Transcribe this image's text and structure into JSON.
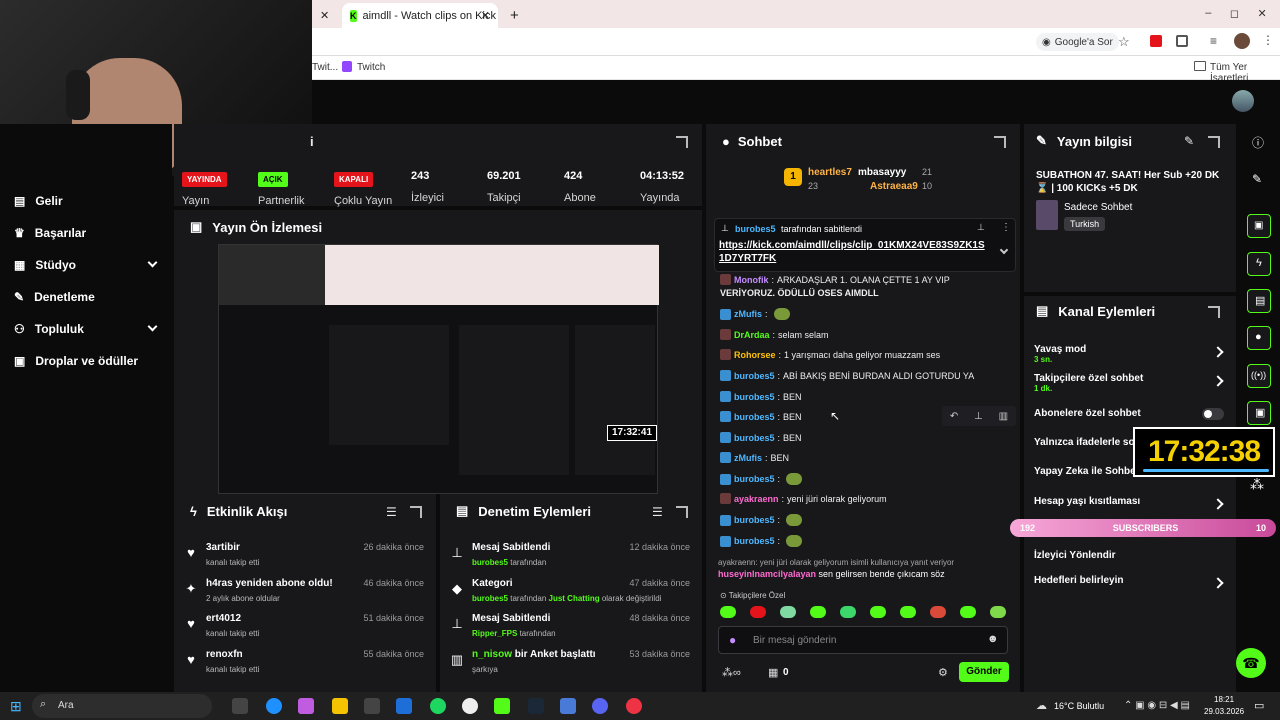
{
  "browser": {
    "tab_title": "aimdll - Watch clips on Kick",
    "new_tab": "+",
    "window_controls": [
      "–",
      "◻",
      "✕"
    ],
    "google_sor": "Google'a Sor",
    "bookmarks": [
      "Twit...",
      "Twitch"
    ],
    "all_bookmarks": "Tüm Yer İşaretleri"
  },
  "sidebar": {
    "items": [
      {
        "label": "Gelir",
        "icon": "bank-icon"
      },
      {
        "label": "Başarılar",
        "icon": "trophy-icon"
      },
      {
        "label": "Stüdyo",
        "icon": "studio-icon",
        "expand": true
      },
      {
        "label": "Denetleme",
        "icon": "wrench-icon"
      },
      {
        "label": "Topluluk",
        "icon": "community-icon",
        "expand": true
      },
      {
        "label": "Droplar ve ödüller",
        "icon": "gift-icon"
      }
    ]
  },
  "stats": {
    "title_partial": "i",
    "items": [
      {
        "badge": "YAYINDA",
        "badge_color": "#e5141b",
        "label": "Yayın"
      },
      {
        "badge": "AÇIK",
        "badge_color": "#53fc18",
        "label": "Partnerlik"
      },
      {
        "badge": "KAPALI",
        "badge_color": "#e5141b",
        "label": "Çoklu Yayın"
      },
      {
        "value": "243",
        "label": "İzleyici"
      },
      {
        "value": "69.201",
        "label": "Takipçi"
      },
      {
        "value": "424",
        "label": "Abone"
      },
      {
        "value": "04:13:52",
        "label": "Yayında"
      }
    ]
  },
  "preview": {
    "title": "Yayın Ön İzlemesi",
    "clock": "17:32:41"
  },
  "activity": {
    "title": "Etkinlik Akışı",
    "items": [
      {
        "name": "3artibir",
        "sub": "kanalı takip etti",
        "ago": "26 dakika önce",
        "icon": "heart-icon"
      },
      {
        "name": "h4ras yeniden abone oldu!",
        "sub": "2 aylık abone oldular",
        "ago": "46 dakika önce",
        "icon": "star-icon"
      },
      {
        "name": "ert4012",
        "sub": "kanalı takip etti",
        "ago": "51 dakika önce",
        "icon": "heart-icon"
      },
      {
        "name": "renoxfn",
        "sub": "kanalı takip etti",
        "ago": "55 dakika önce",
        "icon": "heart-icon"
      }
    ]
  },
  "moderation": {
    "title": "Denetim Eylemleri",
    "items": [
      {
        "title": "Mesaj Sabitlendi",
        "user": "burobes5",
        "rest": " tarafından",
        "ago": "12 dakika önce",
        "icon": "pin-icon"
      },
      {
        "title": "Kategori",
        "user": "burobes5",
        "rest": " tarafından ",
        "cat": "Just Chatting",
        "rest2": " olarak değiştirildi",
        "ago": "47 dakika önce",
        "icon": "tag-icon"
      },
      {
        "title": "Mesaj Sabitlendi",
        "user": "Ripper_FPS",
        "rest": " tarafından",
        "ago": "48 dakika önce",
        "icon": "pin-icon"
      },
      {
        "title_user": "n_nisow",
        "title_rest": " bir Anket başlattı",
        "sub": "şarkıya",
        "ago": "53 dakika önce",
        "icon": "poll-icon"
      }
    ]
  },
  "chat": {
    "title": "Sohbet",
    "leaders": [
      {
        "rank": "1",
        "name": "heartles7",
        "count": "23"
      },
      {
        "name": "mbasayyy",
        "count": "21"
      },
      {
        "name": "Astraeaa9",
        "count": "10"
      }
    ],
    "pinned": {
      "by": "burobes5",
      "by_rest": " tarafından sabitlendi",
      "link": "https://kick.com/aimdll/clips/clip_01KMX24VE83S9ZK1S1D7YRT7FK"
    },
    "messages": [
      {
        "user": "Monofik",
        "color": "#c48cff",
        "text": " ARKADAŞLAR 1. OLANA ÇETTE 1 AY VIP"
      },
      {
        "user": "",
        "color": "#ffffff",
        "text": "VERİYORUZ. ÖDÜLLÜ OSES AIMDLL"
      },
      {
        "user": "zMufis",
        "color": "#4db8ff",
        "text": "",
        "emote": true
      },
      {
        "user": "DrArdaa",
        "color": "#53fc18",
        "text": " selam selam"
      },
      {
        "user": "Rohorsee",
        "color": "#ffc107",
        "text": " 1 yarışmacı daha geliyor muazzam ses"
      },
      {
        "user": "burobes5",
        "color": "#4db8ff",
        "text": " ABİ BAKIŞ BENİ BURDAN ALDI GOTURDU YA"
      },
      {
        "user": "burobes5",
        "color": "#4db8ff",
        "text": " BEN"
      },
      {
        "user": "burobes5",
        "color": "#4db8ff",
        "text": " BEN"
      },
      {
        "user": "burobes5",
        "color": "#4db8ff",
        "text": " BEN"
      },
      {
        "user": "zMufis",
        "color": "#4db8ff",
        "text": " BEN"
      },
      {
        "user": "burobes5",
        "color": "#4db8ff",
        "text": "",
        "emote": true
      },
      {
        "user": "ayakraenn",
        "color": "#ff6bd0",
        "text": " yeni jüri olarak geliyorum"
      },
      {
        "user": "burobes5",
        "color": "#4db8ff",
        "text": "",
        "emote": true
      },
      {
        "user": "burobes5",
        "color": "#4db8ff",
        "text": "",
        "emote": true
      }
    ],
    "reply_context": "ayakraenn: yeni jüri olarak geliyorum     isimli kullanıcıya yanıt veriyor",
    "reply_user": "huseyinlnamcilyalayan",
    "reply_text": " sen gelirsen bende çıkıcam söz",
    "followers_only": "Takipçilere Özel",
    "input_placeholder": "Bir mesaj gönderin",
    "points": "0",
    "send": "Gönder"
  },
  "stream_info": {
    "title": "Yayın bilgisi",
    "stream_title": "SUBATHON 47. SAAT! Her Sub +20 DK ⌛ | 100 KICKs +5 DK",
    "category": "Sadece Sohbet",
    "language": "Turkish"
  },
  "channel_actions": {
    "title": "Kanal Eylemleri",
    "items": [
      {
        "label": "Yavaş mod",
        "sub": "3 sn.",
        "type": "chevron"
      },
      {
        "label": "Takipçilere özel sohbet",
        "sub": "1 dk.",
        "type": "chevron"
      },
      {
        "label": "Abonelere özel sohbet",
        "sub": "",
        "type": "toggle"
      },
      {
        "label": "Yalnızca ifadelerle sohbet",
        "sub": "",
        "type": "none"
      },
      {
        "label": "Yapay Zeka ile Sohbet",
        "sub": "",
        "type": "none"
      },
      {
        "label": "Hesap yaşı kısıtlaması",
        "sub": "",
        "type": "chevron"
      },
      {
        "label": "İzleyici Yönlendir",
        "sub": "",
        "type": "none"
      },
      {
        "label": "Hedefleri belirleyin",
        "sub": "",
        "type": "chevron"
      }
    ]
  },
  "overlay": {
    "clock": "17:32:38",
    "sub_left": "192",
    "sub_label": "SUBSCRIBERS",
    "sub_right": "10"
  },
  "taskbar": {
    "search": "Ara",
    "weather": "16°C Bulutlu",
    "time": "18:21",
    "date": "29.03.2026"
  },
  "colors": {
    "accent": "#53fc18",
    "panel": "#18181b",
    "bg": "#0b0b0c",
    "live": "#e5141b"
  }
}
